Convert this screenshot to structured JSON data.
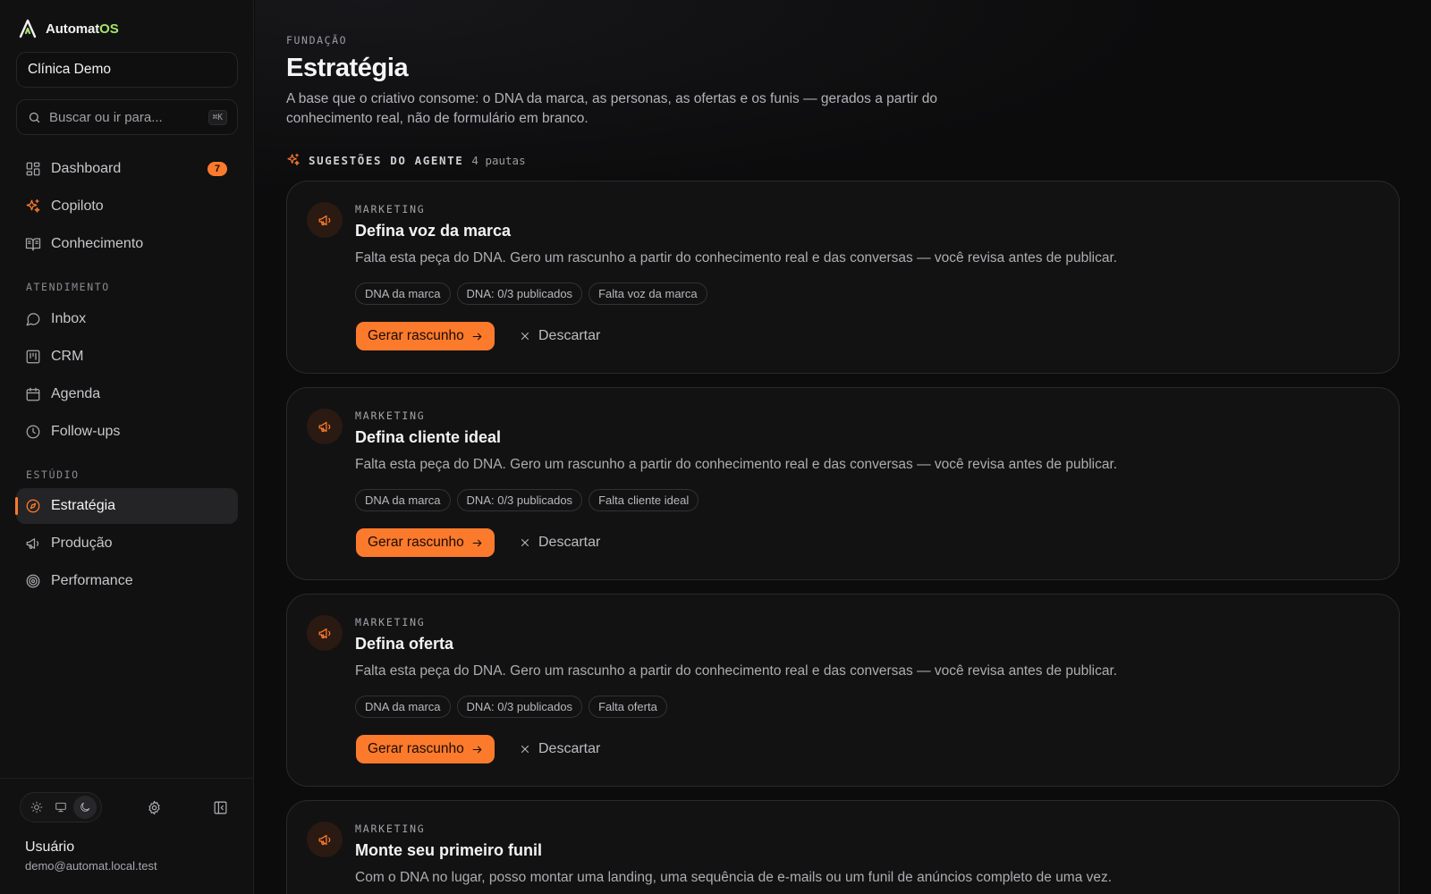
{
  "app": {
    "name": "Automat",
    "name_accent": "OS"
  },
  "workspace": {
    "name": "Clínica Demo"
  },
  "search": {
    "placeholder": "Buscar ou ir para...",
    "shortcut": "⌘K"
  },
  "sidebar": {
    "top_items": [
      {
        "label": "Dashboard",
        "icon": "dashboard-grid-icon",
        "badge": "7"
      },
      {
        "label": "Copiloto",
        "icon": "sparkles-icon"
      },
      {
        "label": "Conhecimento",
        "icon": "book-open-icon"
      }
    ],
    "sections": [
      {
        "label": "ATENDIMENTO",
        "items": [
          {
            "label": "Inbox",
            "icon": "message-circle-icon"
          },
          {
            "label": "CRM",
            "icon": "kanban-icon"
          },
          {
            "label": "Agenda",
            "icon": "calendar-icon"
          },
          {
            "label": "Follow-ups",
            "icon": "clock-icon"
          }
        ]
      },
      {
        "label": "ESTÚDIO",
        "items": [
          {
            "label": "Estratégia",
            "icon": "compass-icon",
            "active": true
          },
          {
            "label": "Produção",
            "icon": "megaphone-icon"
          },
          {
            "label": "Performance",
            "icon": "target-icon"
          }
        ]
      }
    ],
    "theme_options": [
      "light",
      "system",
      "dark"
    ],
    "theme_selected": "dark",
    "user": {
      "name": "Usuário",
      "email": "demo@automat.local.test"
    }
  },
  "page": {
    "eyebrow": "FUNDAÇÃO",
    "title": "Estratégia",
    "description": "A base que o criativo consome: o DNA da marca, as personas, as ofertas e os funis — gerados a partir do conhecimento real, não de formulário em branco."
  },
  "suggestions": {
    "title": "SUGESTÕES DO AGENTE",
    "count": "4 pautas",
    "cards": [
      {
        "category": "MARKETING",
        "title": "Defina voz da marca",
        "description": "Falta esta peça do DNA. Gero um rascunho a partir do conhecimento real e das conversas — você revisa antes de publicar.",
        "tags": [
          "DNA da marca",
          "DNA: 0/3 publicados",
          "Falta voz da marca"
        ],
        "primary": "Gerar rascunho",
        "secondary": "Descartar"
      },
      {
        "category": "MARKETING",
        "title": "Defina cliente ideal",
        "description": "Falta esta peça do DNA. Gero um rascunho a partir do conhecimento real e das conversas — você revisa antes de publicar.",
        "tags": [
          "DNA da marca",
          "DNA: 0/3 publicados",
          "Falta cliente ideal"
        ],
        "primary": "Gerar rascunho",
        "secondary": "Descartar"
      },
      {
        "category": "MARKETING",
        "title": "Defina oferta",
        "description": "Falta esta peça do DNA. Gero um rascunho a partir do conhecimento real e das conversas — você revisa antes de publicar.",
        "tags": [
          "DNA da marca",
          "DNA: 0/3 publicados",
          "Falta oferta"
        ],
        "primary": "Gerar rascunho",
        "secondary": "Descartar"
      },
      {
        "category": "MARKETING",
        "title": "Monte seu primeiro funil",
        "description": "Com o DNA no lugar, posso montar uma landing, uma sequência de e-mails ou um funil de anúncios completo de uma vez.",
        "tags": [],
        "primary": "",
        "secondary": ""
      }
    ]
  },
  "colors": {
    "accent": "#fb7a2c",
    "brand_accent": "#a6e36b",
    "background": "#0c0c0d",
    "sidebar": "#111112",
    "card": "#121213"
  }
}
